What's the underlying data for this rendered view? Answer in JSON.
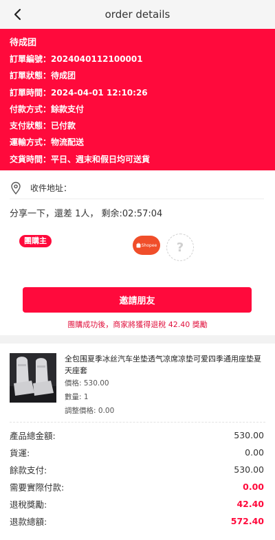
{
  "header": {
    "title": "order details"
  },
  "status": {
    "title": "待成团",
    "rows": [
      {
        "label": "訂單編號：",
        "value": "2024040112100001"
      },
      {
        "label": "訂單狀態：",
        "value": "待成团"
      },
      {
        "label": "訂單時間：",
        "value": "2024-04-01 12:10:26"
      },
      {
        "label": "付款方式：",
        "value": "餘款支付"
      },
      {
        "label": "支付狀態：",
        "value": "已付款"
      },
      {
        "label": "運輸方式：",
        "value": "物流配送"
      },
      {
        "label": "交貨時間：",
        "value": "平日、週末和假日均可送貨"
      }
    ]
  },
  "address": {
    "label": "收件地址："
  },
  "group": {
    "share_text": "分享一下，還差 1人， 剩余:02:57:04",
    "leader_badge": "團購主",
    "member_logo": "Shopee",
    "empty_slot": "?",
    "invite_button": "邀請朋友",
    "reward_note": "團購成功後，商家將獲得退稅 42.40 獎勵"
  },
  "product": {
    "name": "全包围夏季冰丝汽车坐垫透气凉席凉垫可爱四季通用座垫夏天座套",
    "price": "價格: 530.00",
    "quantity": "數量: 1",
    "adjusted_price": "調整價格: 0.00"
  },
  "summary": [
    {
      "label": "產品總金額:",
      "value": "530.00",
      "highlight": false
    },
    {
      "label": "貨運:",
      "value": "0.00",
      "highlight": false
    },
    {
      "label": "餘款支付:",
      "value": "530.00",
      "highlight": false
    },
    {
      "label": "需要實際付款:",
      "value": "0.00",
      "highlight": true
    },
    {
      "label": "退稅獎勵:",
      "value": "42.40",
      "highlight": true
    },
    {
      "label": "退款總額:",
      "value": "572.40",
      "highlight": true
    }
  ],
  "colors": {
    "accent": "#ff0a3c",
    "shopee": "#f04e2a"
  }
}
